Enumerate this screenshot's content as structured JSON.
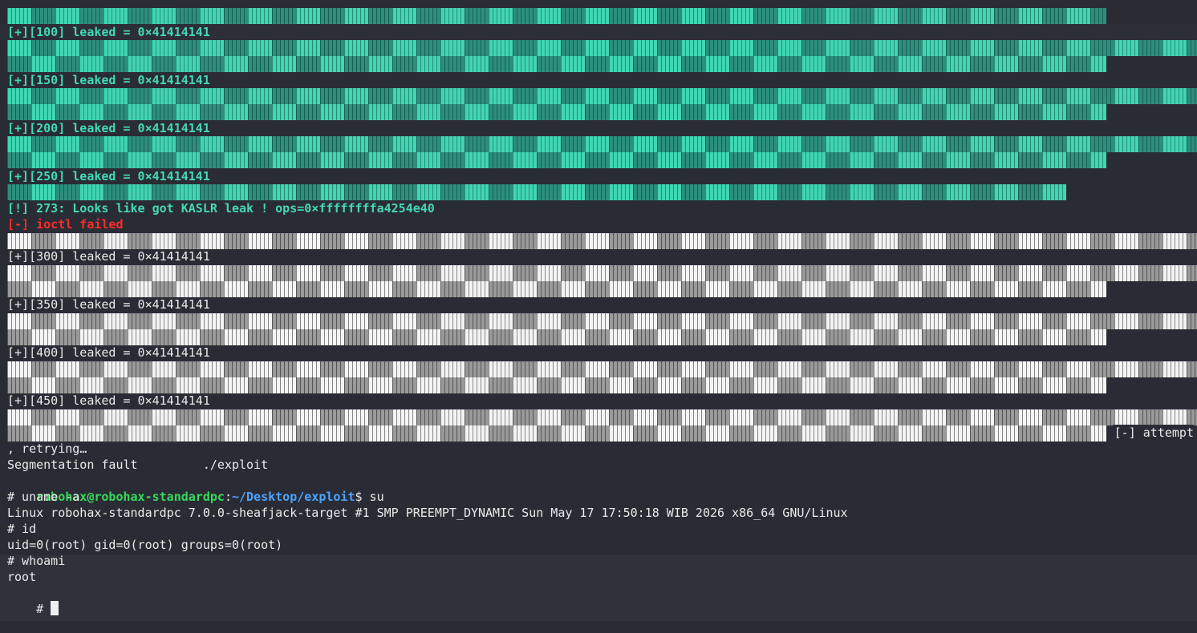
{
  "terminal": {
    "leak_lines": [
      "[+][100] leaked = 0×41414141",
      "[+][150] leaked = 0×41414141",
      "[+][200] leaked = 0×41414141",
      "[+][250] leaked = 0×41414141",
      "[+][300] leaked = 0×41414141",
      "[+][350] leaked = 0×41414141",
      "[+][400] leaked = 0×41414141",
      "[+][450] leaked = 0×41414141"
    ],
    "kaslr_line": "[!] 273: Looks like got KASLR leak ! ops=0×ffffffffa4254e40",
    "ioctl_line": "[-] ioctl failed",
    "attempt_text": "[-] attempt",
    "retrying_line": ", retrying…",
    "segfault_line": "Segmentation fault         ./exploit",
    "prompt": {
      "user_host": "robohax@robohax-standardpc",
      "separator": ":",
      "path": "~/Desktop/exploit",
      "symbol": "$",
      "command": " su"
    },
    "root_session": [
      "# uname -a",
      "Linux robohax-standardpc 7.0.0-sheafjack-target #1 SMP PREEMPT_DYNAMIC Sun May 17 17:50:18 WIB 2026 x86_64 GNU/Linux",
      "# id",
      "uid=0(root) gid=0(root) groups=0(root)",
      "# whoami",
      "root"
    ],
    "final_prompt": "# "
  },
  "colors": {
    "background": "#2a2c35",
    "teal": "#44d8b6",
    "red": "#ff2b2b",
    "green": "#36d95a",
    "blue": "#4aa3ff"
  },
  "icons": {
    "cursor": "block-cursor"
  }
}
